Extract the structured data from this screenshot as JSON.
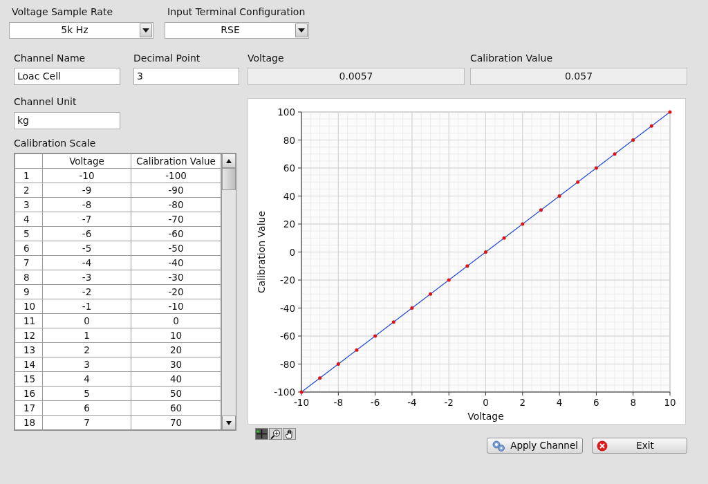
{
  "sample_rate": {
    "label": "Voltage Sample Rate",
    "value": "5k Hz"
  },
  "terminal_config": {
    "label": "Input Terminal Configuration",
    "value": "RSE"
  },
  "channel_name": {
    "label": "Channel Name",
    "value": "Loac Cell"
  },
  "decimal_point": {
    "label": "Decimal Point",
    "value": "3"
  },
  "voltage": {
    "label": "Voltage",
    "value": "0.0057"
  },
  "calibration_value": {
    "label": "Calibration Value",
    "value": "0.057"
  },
  "channel_unit": {
    "label": "Channel Unit",
    "value": "kg"
  },
  "calibration_scale": {
    "label": "Calibration Scale",
    "columns": [
      "Voltage",
      "Calibration Value"
    ],
    "rows": [
      {
        "index": "1",
        "voltage": "-10",
        "calibration_value": "-100"
      },
      {
        "index": "2",
        "voltage": "-9",
        "calibration_value": "-90"
      },
      {
        "index": "3",
        "voltage": "-8",
        "calibration_value": "-80"
      },
      {
        "index": "4",
        "voltage": "-7",
        "calibration_value": "-70"
      },
      {
        "index": "5",
        "voltage": "-6",
        "calibration_value": "-60"
      },
      {
        "index": "6",
        "voltage": "-5",
        "calibration_value": "-50"
      },
      {
        "index": "7",
        "voltage": "-4",
        "calibration_value": "-40"
      },
      {
        "index": "8",
        "voltage": "-3",
        "calibration_value": "-30"
      },
      {
        "index": "9",
        "voltage": "-2",
        "calibration_value": "-20"
      },
      {
        "index": "10",
        "voltage": "-1",
        "calibration_value": "-10"
      },
      {
        "index": "11",
        "voltage": "0",
        "calibration_value": "0"
      },
      {
        "index": "12",
        "voltage": "1",
        "calibration_value": "10"
      },
      {
        "index": "13",
        "voltage": "2",
        "calibration_value": "20"
      },
      {
        "index": "14",
        "voltage": "3",
        "calibration_value": "30"
      },
      {
        "index": "15",
        "voltage": "4",
        "calibration_value": "40"
      },
      {
        "index": "16",
        "voltage": "5",
        "calibration_value": "50"
      },
      {
        "index": "17",
        "voltage": "6",
        "calibration_value": "60"
      },
      {
        "index": "18",
        "voltage": "7",
        "calibration_value": "70"
      }
    ]
  },
  "graph": {
    "chart_data": {
      "type": "line",
      "xlabel": "Voltage",
      "ylabel": "Calibration Value",
      "x": [
        -10,
        -9,
        -8,
        -7,
        -6,
        -5,
        -4,
        -3,
        -2,
        -1,
        0,
        1,
        2,
        3,
        4,
        5,
        6,
        7,
        8,
        9,
        10
      ],
      "series": [
        {
          "color": "#1f48d8",
          "values": [
            -100,
            -90,
            -80,
            -70,
            -60,
            -50,
            -40,
            -30,
            -20,
            -10,
            0,
            10,
            20,
            30,
            40,
            50,
            60,
            70,
            80,
            90,
            100
          ]
        }
      ],
      "grid": true,
      "xlim": [
        -10,
        10
      ],
      "ylim": [
        -100,
        100
      ],
      "xticks": [
        -10,
        -8,
        -6,
        -4,
        -2,
        0,
        2,
        4,
        6,
        8,
        10
      ],
      "yticks": [
        -100,
        -80,
        -60,
        -40,
        -20,
        0,
        20,
        40,
        60,
        80,
        100
      ]
    }
  },
  "graph_tools": [
    {
      "kind": "cursor",
      "selected": true
    },
    {
      "kind": "zoom",
      "selected": false
    },
    {
      "kind": "pan",
      "selected": false
    }
  ],
  "buttons": [
    {
      "kind": "apply",
      "label": "Apply Channel"
    },
    {
      "kind": "exit",
      "label": "Exit"
    }
  ]
}
